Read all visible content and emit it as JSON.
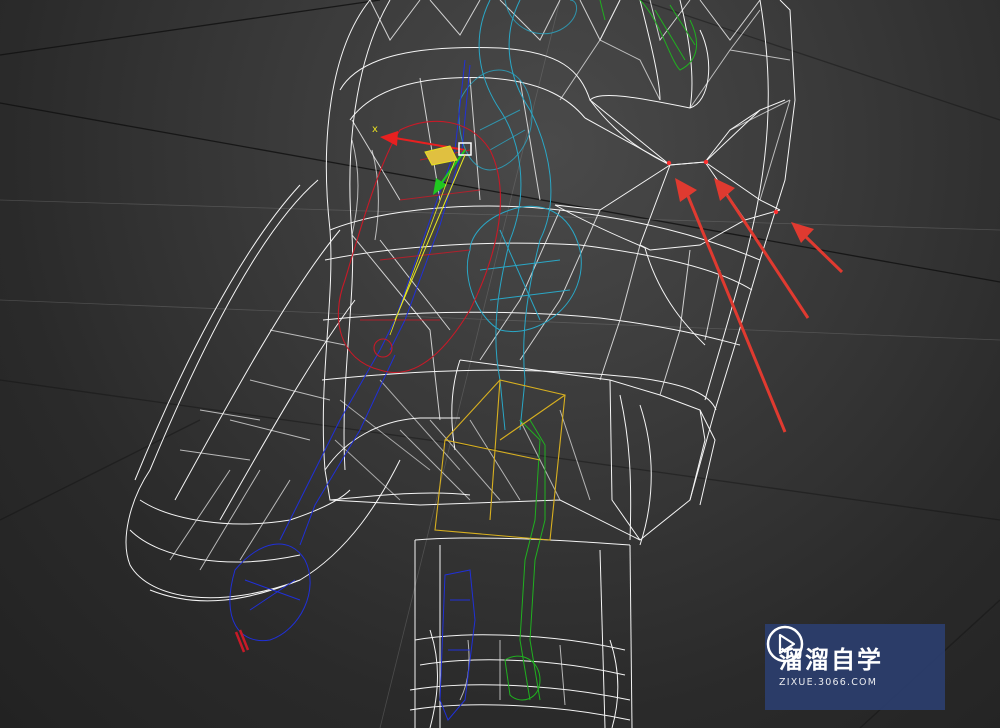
{
  "viewport": {
    "background": "#2f2f2f",
    "wire_color": "#ffffff",
    "bone_colors": {
      "left": "#1f2bd6",
      "right": "#1fa51f",
      "spine": "#2ba8c8",
      "selected": "#d61f1f",
      "hip": "#d6b41f"
    }
  },
  "gizmo": {
    "axis_x_label": "x",
    "axis_x_color": "#e82020",
    "axis_y_color": "#20c820"
  },
  "annotations": {
    "arrow_color": "#e03a30",
    "count": 3
  },
  "watermark": {
    "title": "溜溜自学",
    "subtitle": "ZIXUE.3066.COM",
    "logo_icon": "play-icon"
  }
}
